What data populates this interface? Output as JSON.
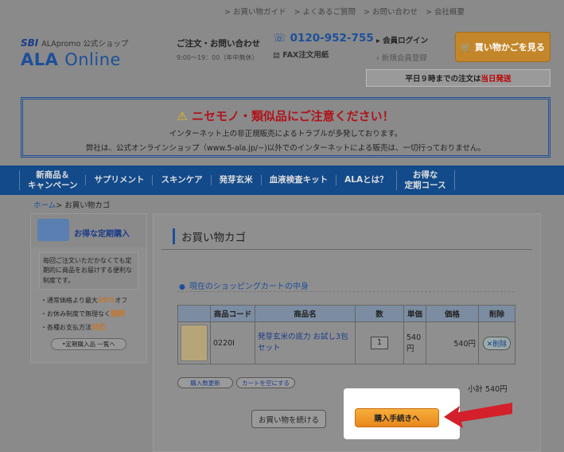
{
  "toplinks": [
    "お買い物ガイド",
    "よくあるご質問",
    "お問い合わせ",
    "会社概要"
  ],
  "logo": {
    "sbi": "SBI",
    "shop": "ALApromo 公式ショップ",
    "ala": "ALA",
    "online": "Online"
  },
  "contact": {
    "title": "ご注文・お問い合わせ",
    "hours": "9:00～19：00（年中無休）",
    "phone": "0120-952-755",
    "fax": "FAX注文用紙"
  },
  "login": {
    "login": "会員ログイン",
    "register": "新規会員登録"
  },
  "cart_button": "買い物かごを見る",
  "notice": {
    "text": "平日９時までの注文は",
    "red": "当日発送"
  },
  "warning": {
    "title": "ニセモノ・類似品にご注意ください！",
    "line1": "インターネット上の非正規販売によるトラブルが多発しております。",
    "line2": "弊社は、公式オンラインショップ（www.5-ala.jp/~)以外でのインターネットによる販売は、一切行っておりません。"
  },
  "nav": [
    "新商品＆\nキャンペーン",
    "サプリメント",
    "スキンケア",
    "発芽玄米",
    "血液検査キット",
    "ALAとは？",
    "お得な\n定期コース"
  ],
  "breadcrumb": {
    "home": "ホーム",
    "current": "お買い物カゴ"
  },
  "side": {
    "title": "お得な定期購入",
    "desc": "毎回ご注文いただかなくても定期的に商品をお届けする便利な制度です。",
    "items": [
      {
        "pre": "通常価格より最大",
        "hi": "20%",
        "post": "オフ"
      },
      {
        "pre": "お休み制度で無理なく",
        "hi": "継続",
        "post": ""
      },
      {
        "pre": "各種お支払方法",
        "hi": "対応",
        "post": ""
      }
    ],
    "button": "定期購入品 一覧へ"
  },
  "main": {
    "title": "お買い物カゴ",
    "subtitle": "現在のショッピングカートの中身",
    "headers": [
      "",
      "商品コード",
      "商品名",
      "数",
      "単価",
      "価格",
      "削除"
    ],
    "row": {
      "code": "0220I",
      "name": "発芽玄米の底力 お試し3包セット",
      "qty": "1",
      "unit": "540円",
      "price": "540円",
      "delete": "削除"
    },
    "btn_recalc": "購入数更新",
    "btn_clear": "カートを空にする",
    "subtotal": "小計 540円",
    "btn_continue": "お買い物を続ける",
    "btn_buy": "購入手続きへ"
  }
}
